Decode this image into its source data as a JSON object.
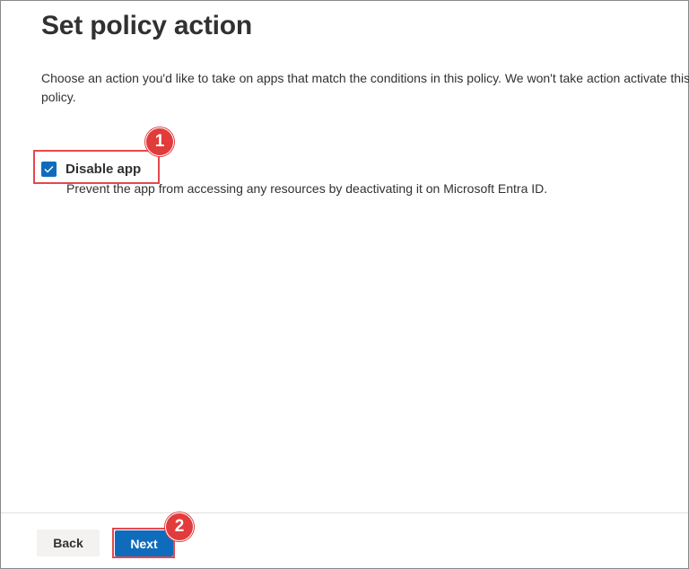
{
  "page": {
    "title": "Set policy action",
    "description": "Choose an action you'd like to take on apps that match the conditions in this policy. We won't take action activate this policy."
  },
  "action_option": {
    "label": "Disable app",
    "checked": true,
    "description": "Prevent the app from accessing any resources by deactivating it on Microsoft Entra ID."
  },
  "annotations": {
    "step1": "1",
    "step2": "2"
  },
  "footer": {
    "back_label": "Back",
    "next_label": "Next"
  },
  "colors": {
    "accent": "#0f6cbd",
    "highlight": "#e5484d",
    "badge": "#e23b3b"
  }
}
